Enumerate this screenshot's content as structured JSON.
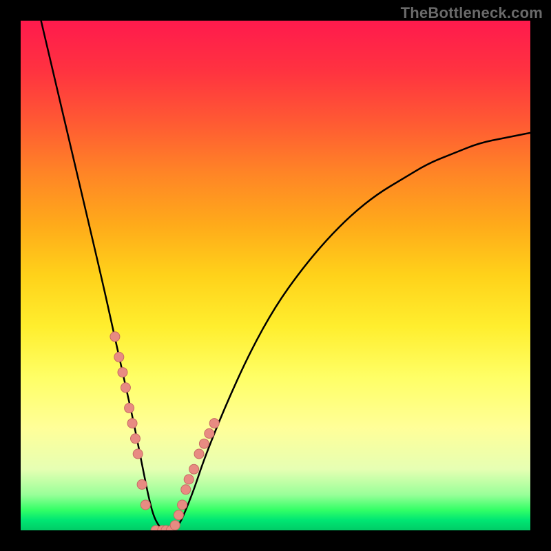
{
  "watermark": "TheBottleneck.com",
  "colors": {
    "bead_fill": "#e88b82",
    "bead_stroke": "#c76b63",
    "curve": "#000000"
  },
  "chart_data": {
    "type": "line",
    "title": "",
    "xlabel": "",
    "ylabel": "",
    "xlim": [
      0,
      100
    ],
    "ylim": [
      0,
      100
    ],
    "note": "No axes, tick labels, or legend are rendered in the image; values are estimated from pixel positions. y=0 at bottom (green), y=100 at top (red).",
    "series": [
      {
        "name": "curve",
        "x": [
          4,
          8,
          12,
          16,
          18,
          20,
          22,
          23,
          24,
          25,
          26,
          27,
          28,
          29,
          30,
          31,
          32,
          34,
          36,
          40,
          45,
          50,
          55,
          60,
          65,
          70,
          75,
          80,
          85,
          90,
          95,
          100
        ],
        "y": [
          100,
          83,
          66,
          49,
          40,
          31,
          22,
          17,
          12,
          7,
          3,
          1,
          0,
          0,
          0,
          1,
          3,
          8,
          14,
          24,
          35,
          44,
          51,
          57,
          62,
          66,
          69,
          72,
          74,
          76,
          77,
          78
        ]
      }
    ],
    "beads": {
      "name": "highlighted-points",
      "x": [
        18.5,
        19.3,
        20.0,
        20.6,
        21.3,
        21.9,
        22.5,
        23.0,
        23.8,
        24.5,
        26.5,
        27.8,
        28.5,
        29.5,
        30.3,
        31.0,
        31.7,
        32.4,
        33.0,
        34.0,
        35.0,
        36.0,
        37.0,
        38.0
      ],
      "y": [
        38,
        34,
        31,
        28,
        24,
        21,
        18,
        15,
        9,
        5,
        0,
        0,
        0,
        0,
        1,
        3,
        5,
        8,
        10,
        12,
        15,
        17,
        19,
        21
      ]
    }
  }
}
